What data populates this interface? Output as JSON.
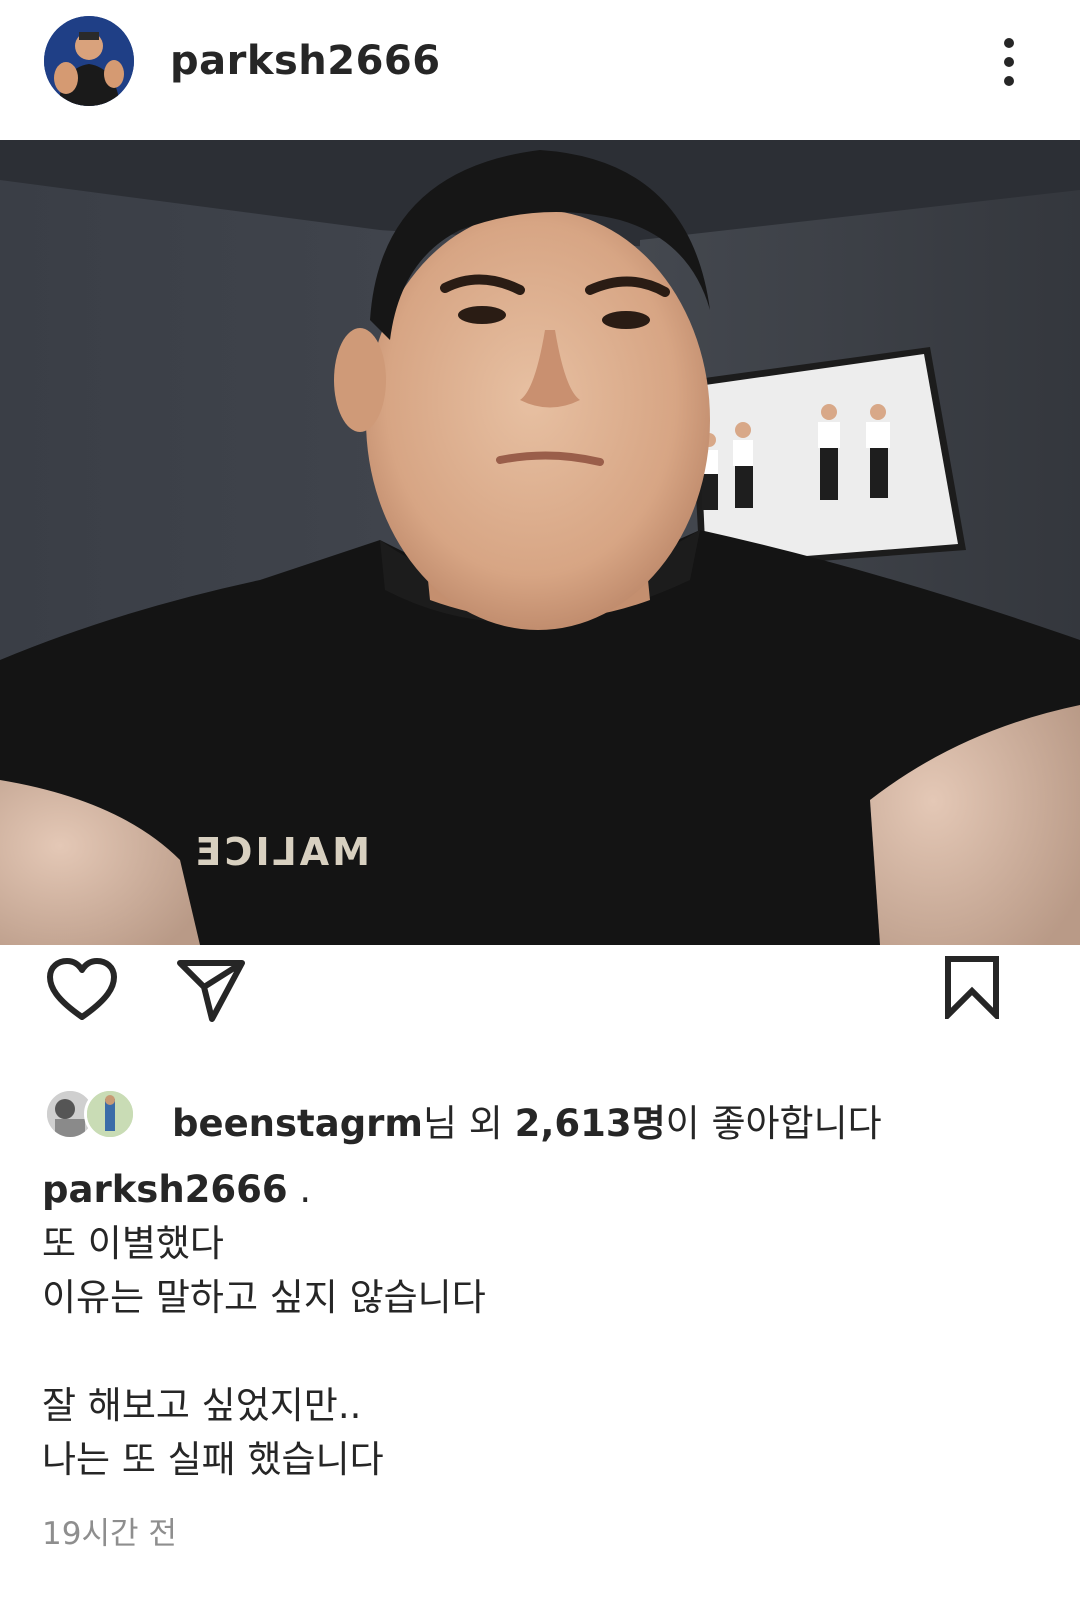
{
  "post": {
    "username": "parksh2666",
    "more_icon": "more-vertical-icon",
    "photo_shirt_text": "MALICE",
    "actions": {
      "like_icon": "heart-icon",
      "share_icon": "send-icon",
      "save_icon": "bookmark-icon"
    },
    "likes": {
      "first_liker": "beenstagrm",
      "suffix": "님 외 ",
      "count": "2,613명",
      "tail": "이 좋아합니다"
    },
    "caption": {
      "username": "parksh2666",
      "first_line_tail": " .",
      "lines": [
        "또 이별했다",
        "이유는 말하고 싶지 않습니다",
        "",
        "잘 해보고 싶었지만..",
        "나는 또 실패 했습니다"
      ]
    },
    "timestamp": "19시간 전"
  },
  "colors": {
    "text": "#262626",
    "muted": "#8e8e8e",
    "background": "#ffffff"
  }
}
